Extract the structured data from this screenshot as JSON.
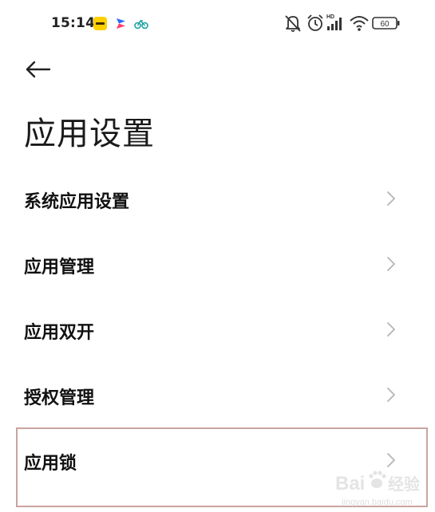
{
  "status_bar": {
    "time": "15:14",
    "battery": "60",
    "notification_icons": [
      "meituan-icon",
      "video-app-icon",
      "bike-app-icon"
    ],
    "system_icons": [
      "bell-off-icon",
      "alarm-clock-icon",
      "hd-signal-icon",
      "wifi-icon",
      "battery-icon"
    ]
  },
  "header": {
    "back_icon": "back-arrow-icon",
    "title": "应用设置"
  },
  "settings": {
    "items": [
      {
        "label": "系统应用设置"
      },
      {
        "label": "应用管理"
      },
      {
        "label": "应用双开"
      },
      {
        "label": "授权管理"
      },
      {
        "label": "应用锁"
      }
    ]
  },
  "watermark": {
    "brand": "Bai",
    "brand_cn": "经验",
    "url": "jingyan.baidu.com"
  },
  "colors": {
    "highlight_border": "#c9a4a0",
    "chevron": "#b5b5b5",
    "badge_yellow": "#ffd000"
  }
}
